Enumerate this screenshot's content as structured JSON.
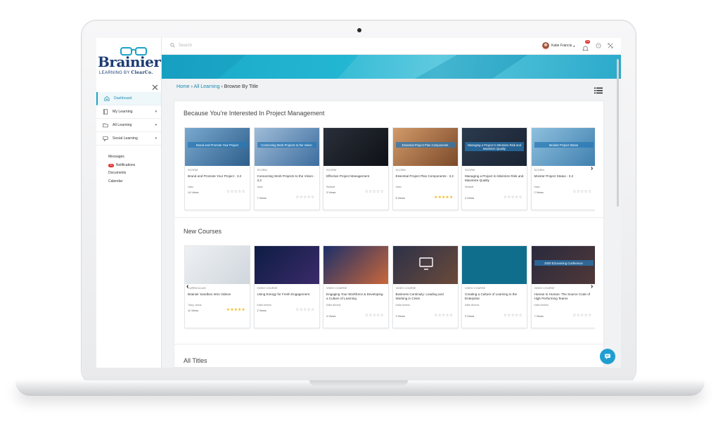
{
  "logo": {
    "brand": "Brainier",
    "tagline_prefix": "LEARNING BY",
    "tagline_company": "ClearCo."
  },
  "topbar": {
    "search_placeholder": "Search",
    "user_name": "Katie Francis",
    "notification_count": "44"
  },
  "sidebar": {
    "items": [
      {
        "label": "Dashboard",
        "active": true,
        "icon": "home-icon"
      },
      {
        "label": "My Learning",
        "icon": "book-icon"
      },
      {
        "label": "All Learning",
        "icon": "folder-icon"
      },
      {
        "label": "Social Learning",
        "icon": "chat-icon"
      }
    ],
    "links": [
      "Messages",
      "Notifications",
      "Documents",
      "Calendar"
    ],
    "notifications_badge": "44"
  },
  "breadcrumb": {
    "home": "Home",
    "all_learning": "All Learning",
    "current": "Browse By Title"
  },
  "sections": {
    "interested": {
      "title": "Because You're Interested In Project Management",
      "cards": [
        {
          "type": "SCORM",
          "title": "Brand and Promote Your Project - 3.2",
          "author": "Vado",
          "views": "14 Views",
          "rating": 0,
          "caption": "Brand and Promote Your Project"
        },
        {
          "type": "SCORM",
          "title": "Connecting Work Projects to the Vision - 3.2",
          "author": "Vado",
          "views": "7 Views",
          "rating": 0,
          "caption": "Connecting Work Projects to the Vision"
        },
        {
          "type": "SCORM",
          "title": "Effective Project Management",
          "author": "Skillsoft",
          "views": "3 Views",
          "rating": 0,
          "caption": ""
        },
        {
          "type": "SCORM",
          "title": "Essential Project Plan Components - 3.2",
          "author": "Vado",
          "views": "6 Views",
          "rating": 5,
          "caption": "Essential Project Plan Components"
        },
        {
          "type": "SCORM",
          "title": "Managing a Project to Minimize Risk and Maximize Quality",
          "author": "Skillsoft",
          "views": "4 Views",
          "rating": 0,
          "caption": "Managing a Project to Minimize Risk and Maximize Quality"
        },
        {
          "type": "SCORM",
          "title": "Monitor Project Status - 3.2",
          "author": "Vado",
          "views": "2 Views",
          "rating": 0,
          "caption": "Monitor Project Status"
        }
      ]
    },
    "new_courses": {
      "title": "New Courses",
      "cards": [
        {
          "type": "CURRICULUM",
          "title": "Brainier Sandbox Intro Videos",
          "author": "Tracy Johns",
          "views": "11 Views",
          "rating": 5,
          "caption": ""
        },
        {
          "type": "VIDEO COURSE",
          "title": "Using Energy for Fresh Engagement",
          "author": "Katie Ahrens",
          "views": "2 Views",
          "rating": 0,
          "caption": ""
        },
        {
          "type": "VIDEO COURSE",
          "title": "Engaging Your Workforce & Developing a Culture of Learning",
          "author": "Katie Ahrens",
          "views": "3 Views",
          "rating": 0,
          "caption": ""
        },
        {
          "type": "VIDEO COURSE",
          "title": "Business Continuity: Leading and Working in Crisis",
          "author": "Katie Ahrens",
          "views": "3 Views",
          "rating": 0,
          "caption": ""
        },
        {
          "type": "VIDEO COURSE",
          "title": "Creating a Culture of Learning in the Enterprise",
          "author": "Katie Ahrens",
          "views": "3 Views",
          "rating": 0,
          "caption": ""
        },
        {
          "type": "VIDEO COURSE",
          "title": "Human to Human: The Source Code of High Performing Teams",
          "author": "Katie Ahrens",
          "views": "7 Views",
          "rating": 0,
          "caption": "2020 E3Learning Conference"
        }
      ]
    },
    "all_titles": {
      "title": "All Titles"
    }
  },
  "colors": {
    "accent": "#1aa3c8",
    "brand_navy": "#1e3c73",
    "star_gold": "#f5b400",
    "star_empty": "#9a9a9a"
  }
}
